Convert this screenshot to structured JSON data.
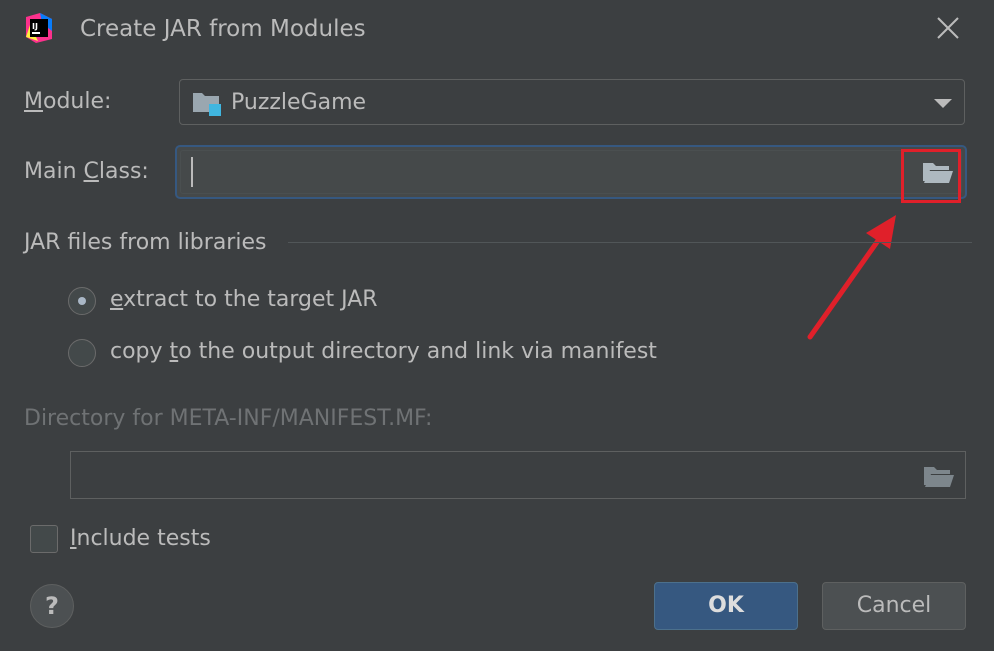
{
  "window": {
    "title": "Create JAR from Modules",
    "app_icon_text": "IJ"
  },
  "module": {
    "label": "Module:",
    "mnemonic": "M",
    "label_rest": "odule:",
    "value": "PuzzleGame"
  },
  "main_class": {
    "label_prefix": "Main ",
    "mnemonic": "C",
    "label_rest": "lass:",
    "value": ""
  },
  "libraries": {
    "section_title": "JAR files from libraries",
    "options": [
      {
        "mnemonic": "e",
        "label_rest": "xtract to the target JAR",
        "selected": true
      },
      {
        "label_prefix": "copy ",
        "mnemonic": "t",
        "label_rest": "o the output directory and link via manifest",
        "selected": false
      }
    ]
  },
  "manifest": {
    "label": "Directory for META-INF/MANIFEST.MF:",
    "value": ""
  },
  "include_tests": {
    "mnemonic": "I",
    "label_rest": "nclude tests",
    "checked": false
  },
  "buttons": {
    "help": "?",
    "ok": "OK",
    "cancel": "Cancel"
  },
  "colors": {
    "background": "#3c3f41",
    "accent": "#365880",
    "highlight": "#e0202a"
  }
}
